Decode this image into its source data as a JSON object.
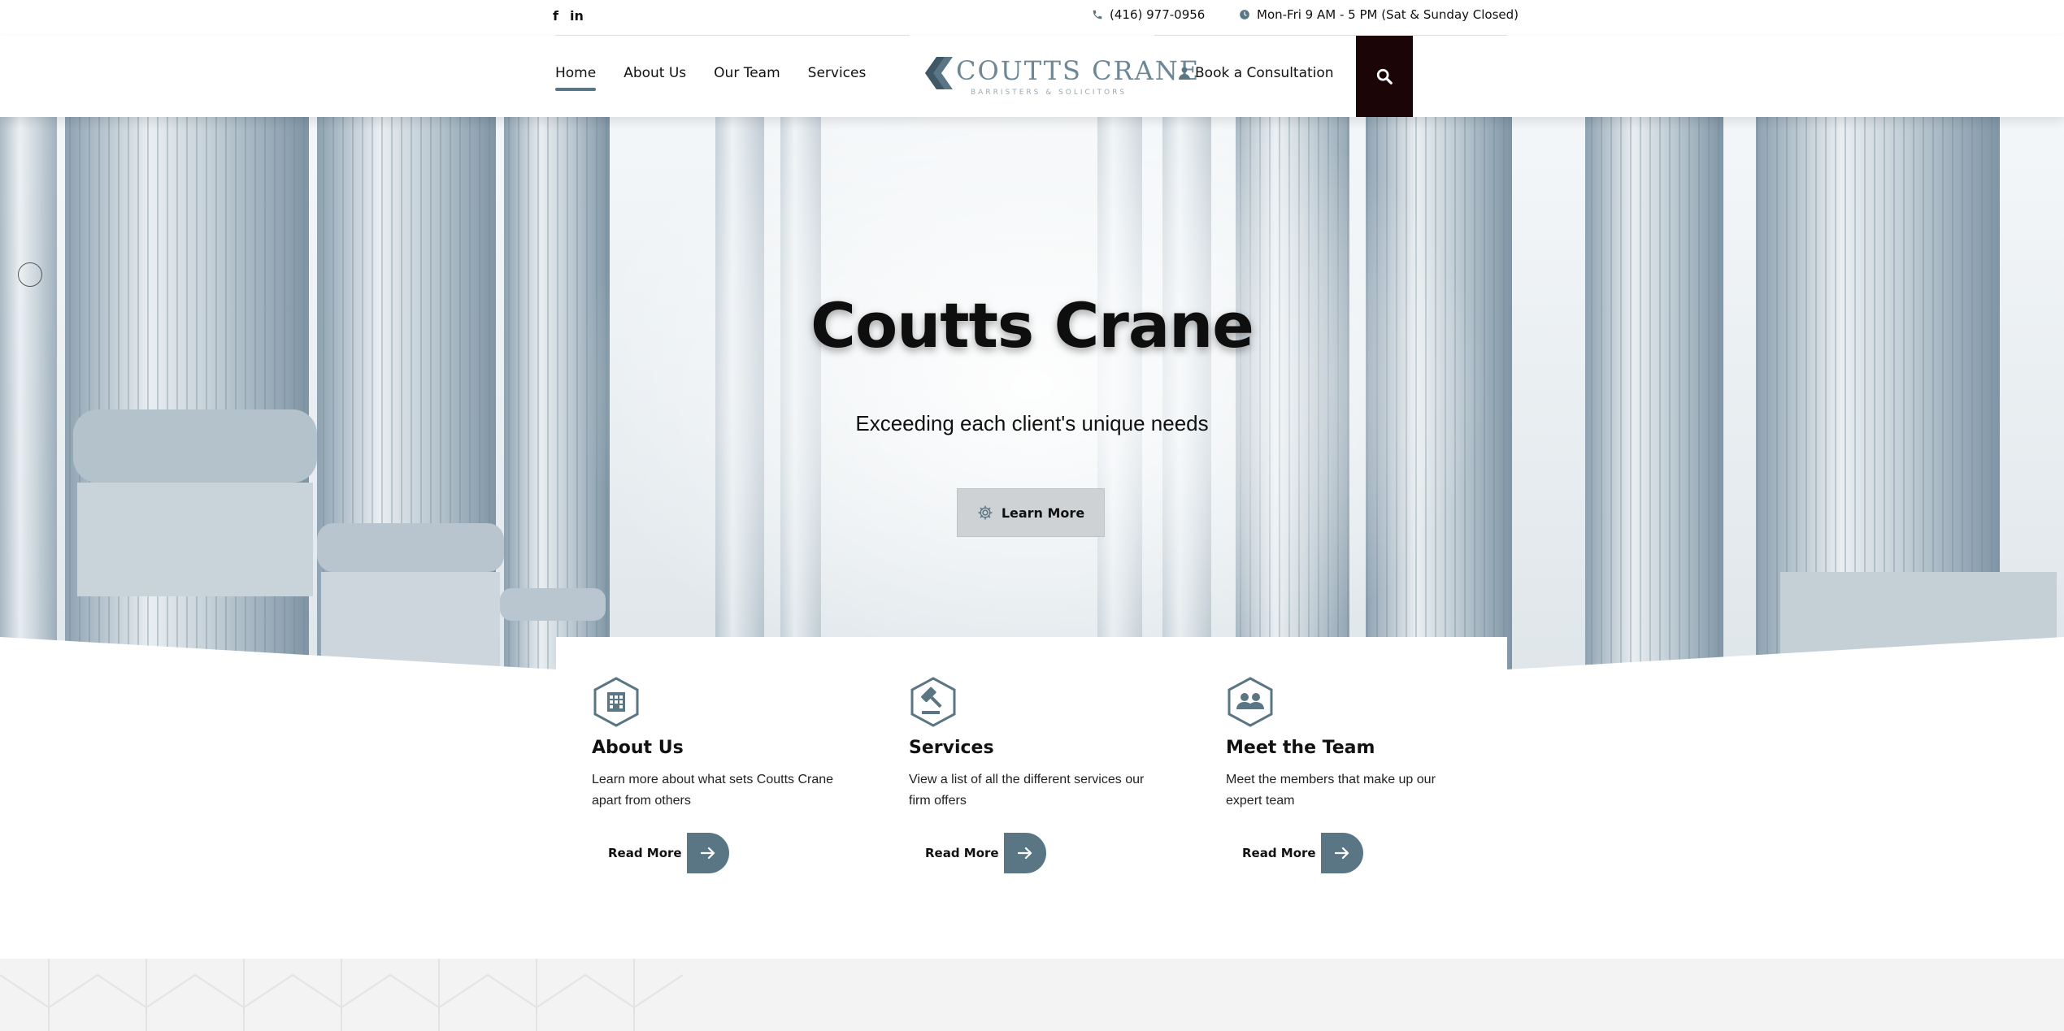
{
  "social": {
    "facebook": "f",
    "linkedin": "in"
  },
  "contact": {
    "phone": "(416) 977-0956",
    "hours": "Mon-Fri 9 AM - 5 PM (Sat & Sunday Closed)"
  },
  "nav": {
    "items": [
      "Home",
      "About Us",
      "Our Team",
      "Services"
    ],
    "active": "Home"
  },
  "logo": {
    "name": "COUTTS CRANE",
    "tagline": "BARRISTERS & SOLICITORS"
  },
  "book": {
    "label": "Book a Consultation"
  },
  "hero": {
    "title": "Coutts Crane",
    "subtitle": "Exceeding each client's unique needs",
    "button": "Learn More"
  },
  "cards": [
    {
      "icon": "building-icon",
      "title": "About Us",
      "text": "Learn more about what sets Coutts Crane apart from others",
      "link": "Read More"
    },
    {
      "icon": "gavel-icon",
      "title": "Services",
      "text": "View a list of all the different services our firm offers",
      "link": "Read More"
    },
    {
      "icon": "team-icon",
      "title": "Meet the Team",
      "text": "Meet the members that make up our expert team",
      "link": "Read More"
    }
  ],
  "colors": {
    "accent": "#5a7584",
    "search_bg": "#1c0506",
    "logo": "#6d8796"
  }
}
